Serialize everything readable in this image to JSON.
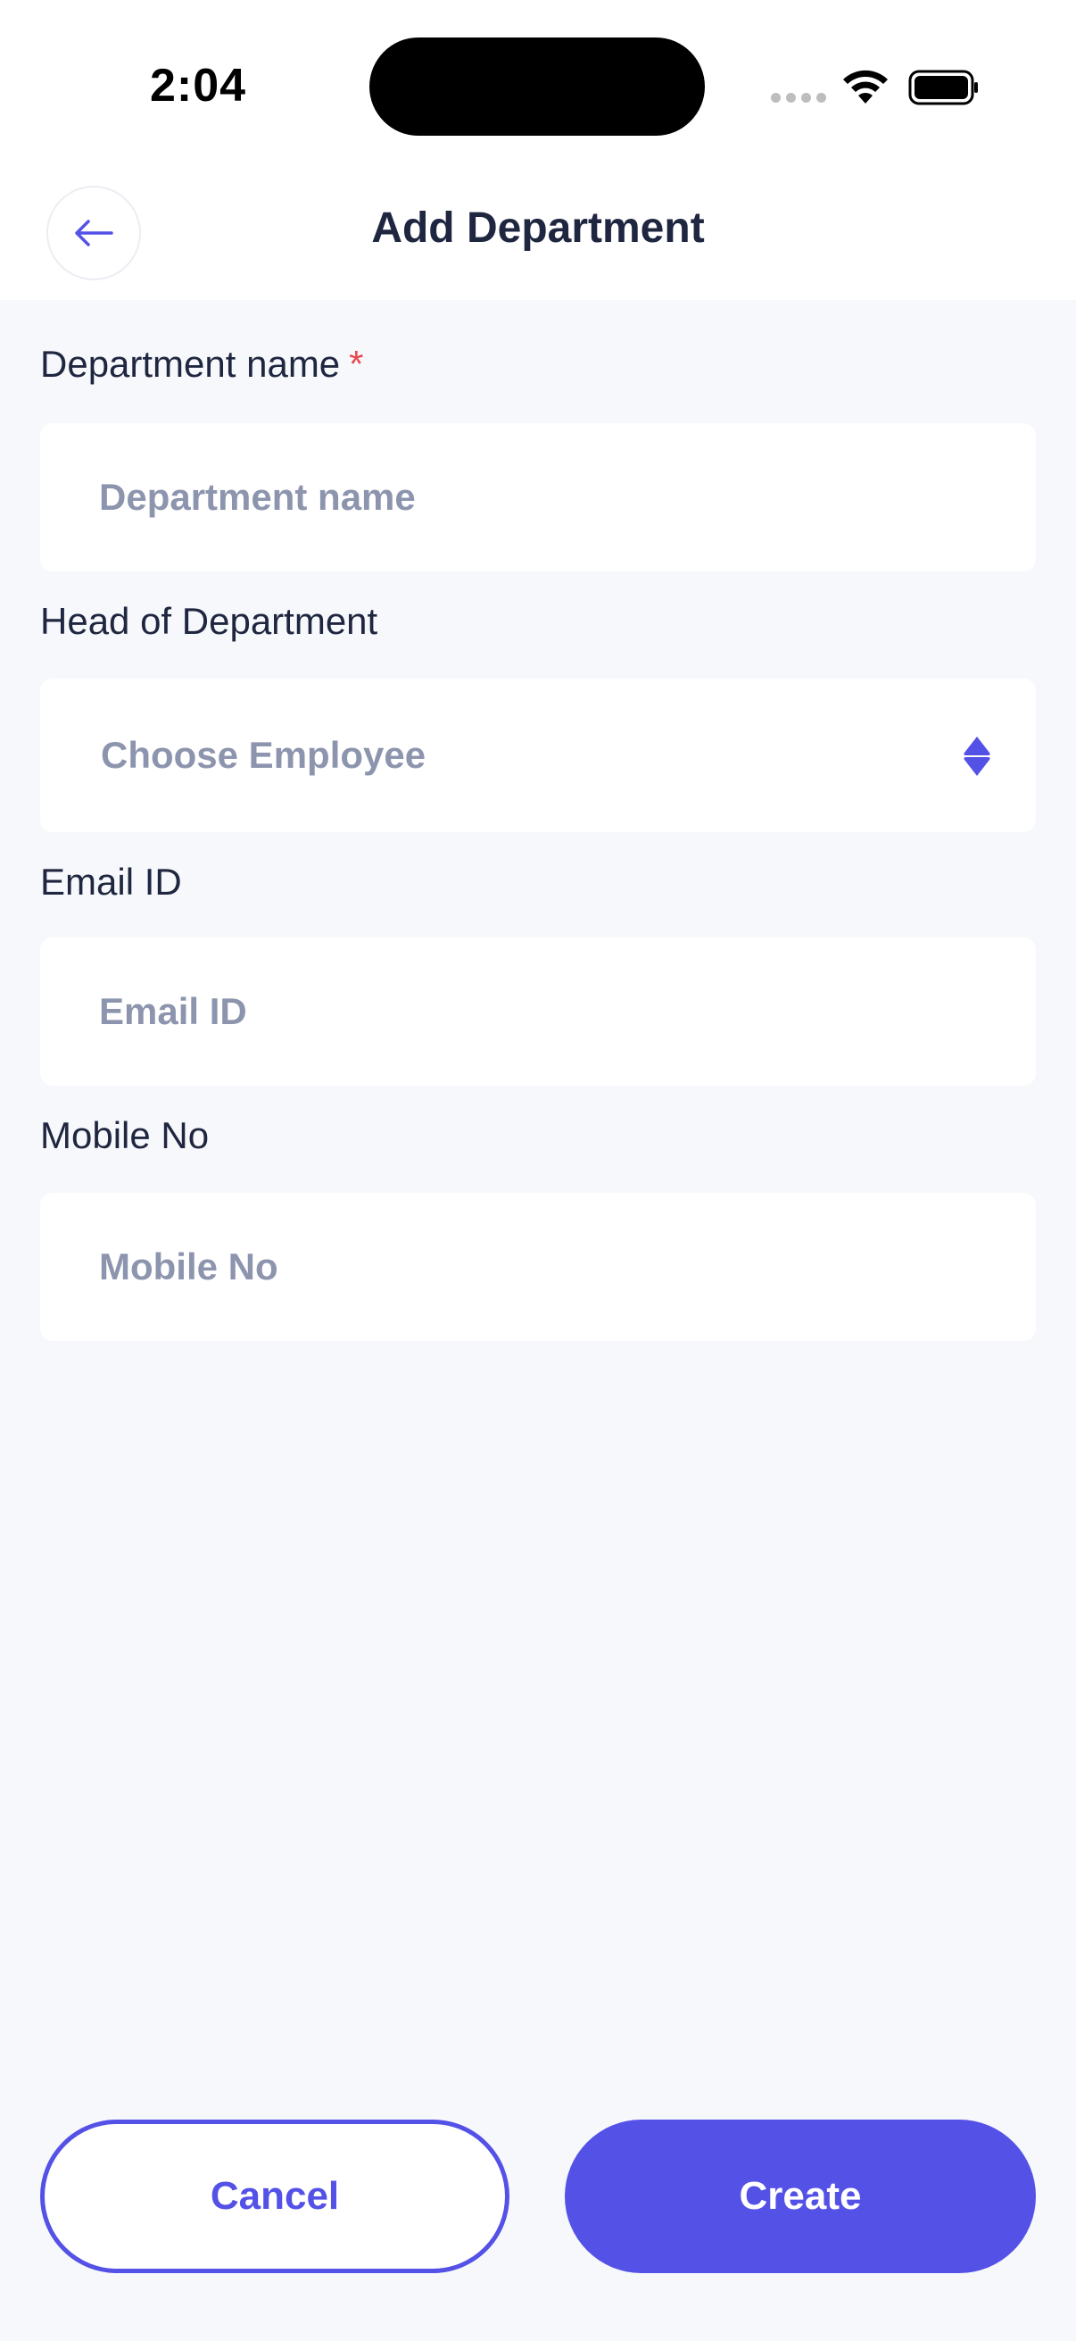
{
  "status_bar": {
    "time": "2:04"
  },
  "header": {
    "title": "Add Department",
    "back_icon": "arrow-left-icon"
  },
  "form": {
    "department_name": {
      "label": "Department name",
      "required_mark": "*",
      "placeholder": "Department name",
      "value": ""
    },
    "head_of_department": {
      "label": "Head of Department",
      "selected": "Choose Employee",
      "icon": "sort-updown-icon"
    },
    "email": {
      "label": "Email ID",
      "placeholder": "Email ID",
      "value": ""
    },
    "mobile": {
      "label": "Mobile No",
      "placeholder": "Mobile No",
      "value": ""
    }
  },
  "actions": {
    "cancel_label": "Cancel",
    "create_label": "Create"
  },
  "colors": {
    "accent": "#5451E7",
    "background": "#F7F8FB",
    "placeholder": "#8D95AE",
    "text": "#1F2640",
    "required": "#E5484D"
  }
}
